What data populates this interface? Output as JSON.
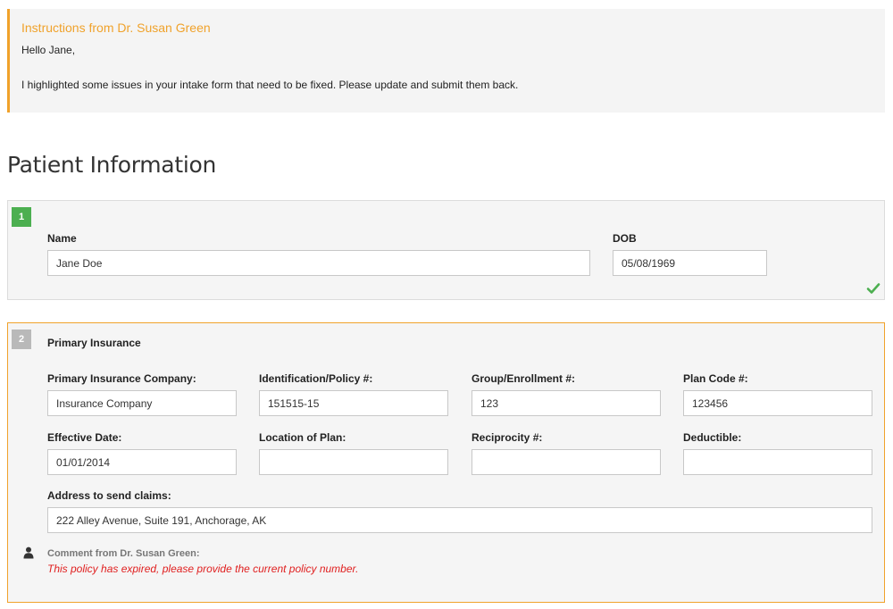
{
  "notice": {
    "title": "Instructions from Dr. Susan Green",
    "greeting": "Hello Jane,",
    "body": "I highlighted some issues in your intake form that need to be fixed. Please update and submit them back."
  },
  "page": {
    "title": "Patient Information"
  },
  "section1": {
    "number": "1",
    "status_icon": "checkmark-icon",
    "fields": {
      "name": {
        "label": "Name",
        "value": "Jane Doe"
      },
      "dob": {
        "label": "DOB",
        "value": "05/08/1969"
      }
    }
  },
  "section2": {
    "number": "2",
    "heading": "Primary Insurance",
    "fields": {
      "company": {
        "label": "Primary Insurance Company:",
        "value": "Insurance Company"
      },
      "policy": {
        "label": "Identification/Policy #:",
        "value": "151515-15"
      },
      "group": {
        "label": "Group/Enrollment #:",
        "value": "123"
      },
      "plan_code": {
        "label": "Plan Code #:",
        "value": "123456"
      },
      "effective_date": {
        "label": "Effective Date:",
        "value": "01/01/2014"
      },
      "location": {
        "label": "Location of Plan:",
        "value": ""
      },
      "reciprocity": {
        "label": "Reciprocity #:",
        "value": ""
      },
      "deductible": {
        "label": "Deductible:",
        "value": ""
      },
      "address": {
        "label": "Address to send claims:",
        "value": "222 Alley Avenue, Suite 191, Anchorage, AK"
      }
    },
    "comment": {
      "icon": "user-icon",
      "author": "Comment from Dr. Susan Green:",
      "text": "This policy has expired, please provide the current policy number."
    }
  },
  "colors": {
    "accent": "#f0a22b",
    "success": "#4caf50",
    "error": "#e02020",
    "panel": "#f5f5f5"
  }
}
